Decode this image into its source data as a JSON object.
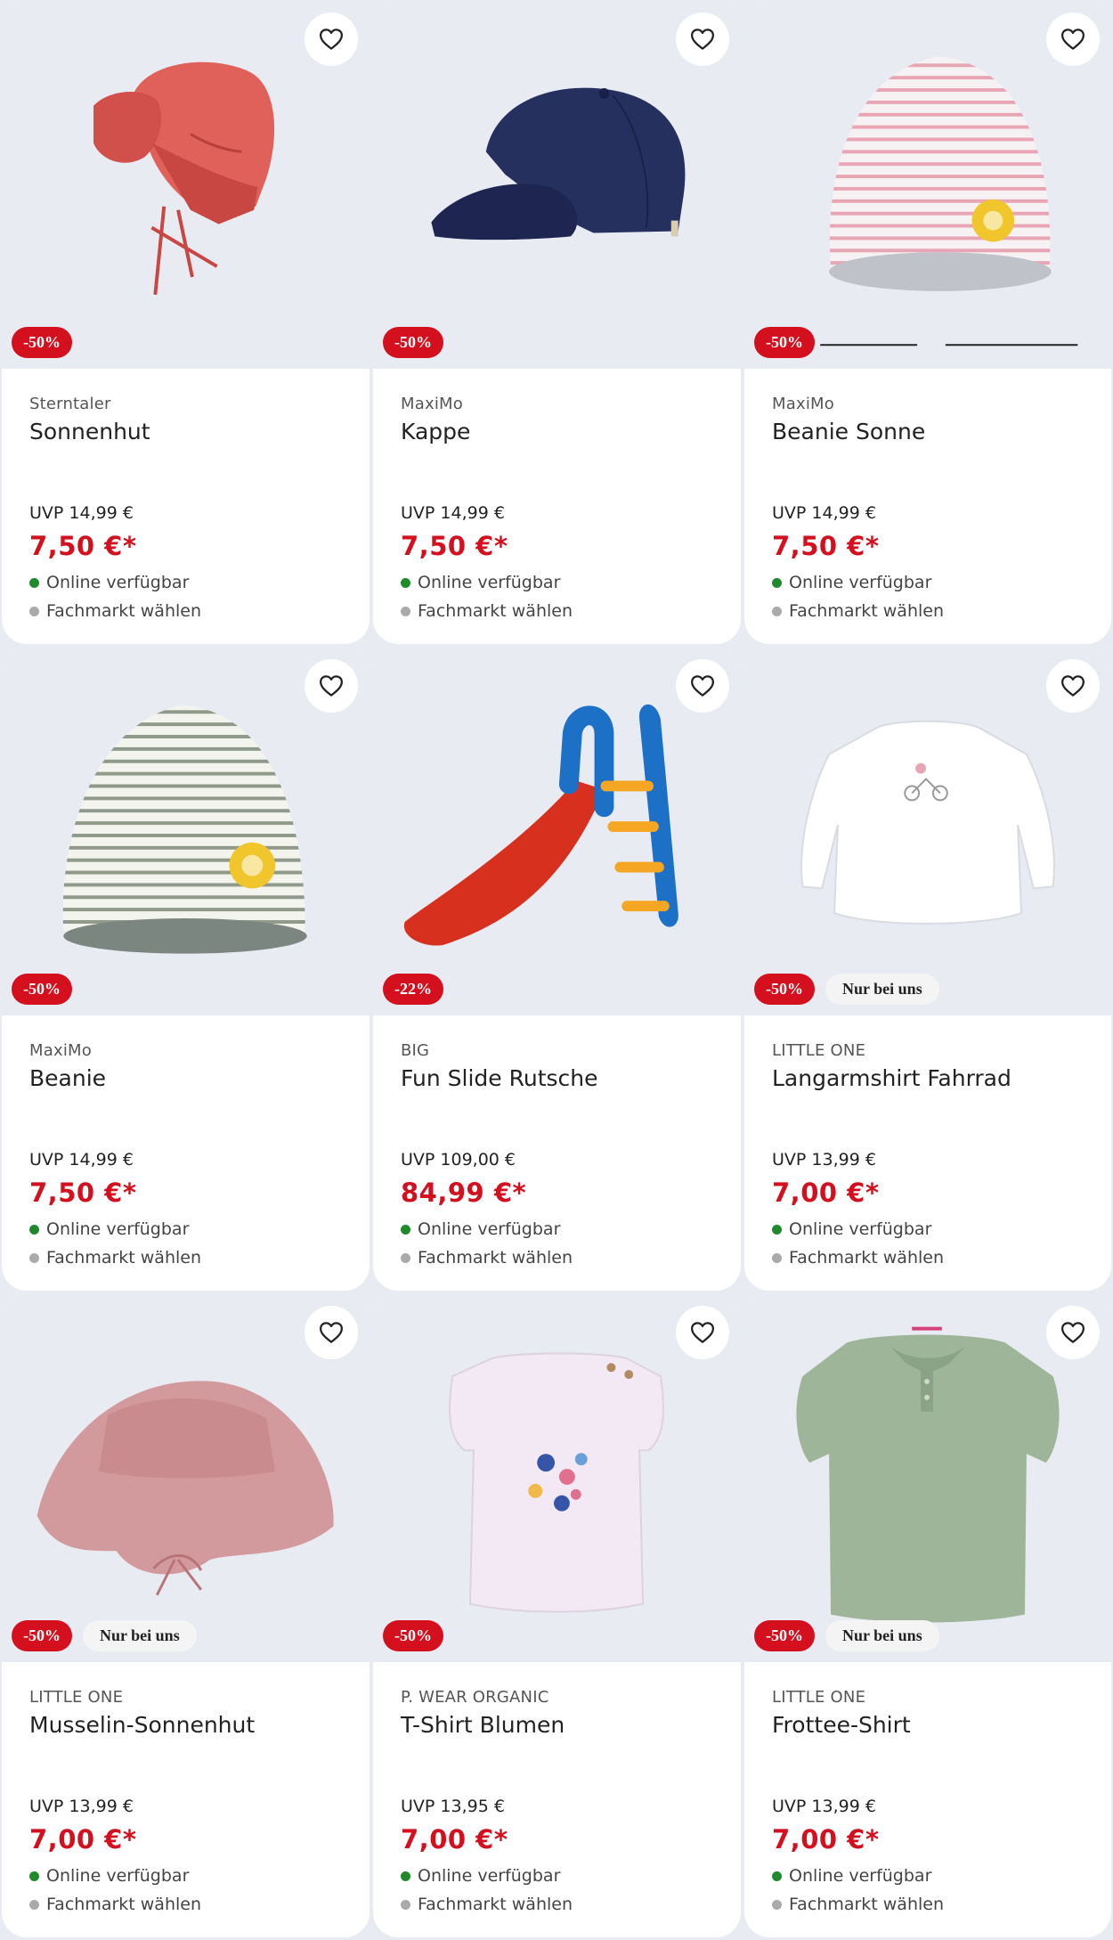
{
  "products": [
    {
      "brand": "Sterntaler",
      "name": "Sonnenhut",
      "uvp": "UVP 14,99 €",
      "price": "7,50 €*",
      "discount": "-50%",
      "exclusive": "",
      "availability": "Online verfügbar",
      "store": "Fachmarkt wählen",
      "image": "sun-hat-red"
    },
    {
      "brand": "MaxiMo",
      "name": "Kappe",
      "uvp": "UVP 14,99 €",
      "price": "7,50 €*",
      "discount": "-50%",
      "exclusive": "",
      "availability": "Online verfügbar",
      "store": "Fachmarkt wählen",
      "image": "cap-navy"
    },
    {
      "brand": "MaxiMo",
      "name": "Beanie Sonne",
      "uvp": "UVP 14,99 €",
      "price": "7,50 €*",
      "discount": "-50%",
      "exclusive": "",
      "availability": "Online verfügbar",
      "store": "Fachmarkt wählen",
      "image": "beanie-pink-stripes"
    },
    {
      "brand": "MaxiMo",
      "name": "Beanie",
      "uvp": "UVP 14,99 €",
      "price": "7,50 €*",
      "discount": "-50%",
      "exclusive": "",
      "availability": "Online verfügbar",
      "store": "Fachmarkt wählen",
      "image": "beanie-grey-stripes"
    },
    {
      "brand": "BIG",
      "name": "Fun Slide Rutsche",
      "uvp": "UVP 109,00 €",
      "price": "84,99 €*",
      "discount": "-22%",
      "exclusive": "",
      "availability": "Online verfügbar",
      "store": "Fachmarkt wählen",
      "image": "slide"
    },
    {
      "brand": "LITTLE ONE",
      "name": "Langarmshirt Fahrrad",
      "uvp": "UVP 13,99 €",
      "price": "7,00 €*",
      "discount": "-50%",
      "exclusive": "Nur bei uns",
      "availability": "Online verfügbar",
      "store": "Fachmarkt wählen",
      "image": "longsleeve-white"
    },
    {
      "brand": "LITTLE ONE",
      "name": "Musselin-Sonnenhut",
      "uvp": "UVP 13,99 €",
      "price": "7,00 €*",
      "discount": "-50%",
      "exclusive": "Nur bei uns",
      "availability": "Online verfügbar",
      "store": "Fachmarkt wählen",
      "image": "muslin-hat-pink"
    },
    {
      "brand": "P. WEAR ORGANIC",
      "name": "T-Shirt Blumen",
      "uvp": "UVP 13,95 €",
      "price": "7,00 €*",
      "discount": "-50%",
      "exclusive": "",
      "availability": "Online verfügbar",
      "store": "Fachmarkt wählen",
      "image": "tshirt-lilac"
    },
    {
      "brand": "LITTLE ONE",
      "name": "Frottee-Shirt",
      "uvp": "UVP 13,99 €",
      "price": "7,00 €*",
      "discount": "-50%",
      "exclusive": "Nur bei uns",
      "availability": "Online verfügbar",
      "store": "Fachmarkt wählen",
      "image": "polo-green"
    }
  ],
  "colors": {
    "sale": "#d40f1e",
    "available": "#1f8a2c",
    "store": "#aaaaaa",
    "background": "#e8ebf2"
  },
  "icons": {
    "favorite": "heart-outline-icon"
  }
}
